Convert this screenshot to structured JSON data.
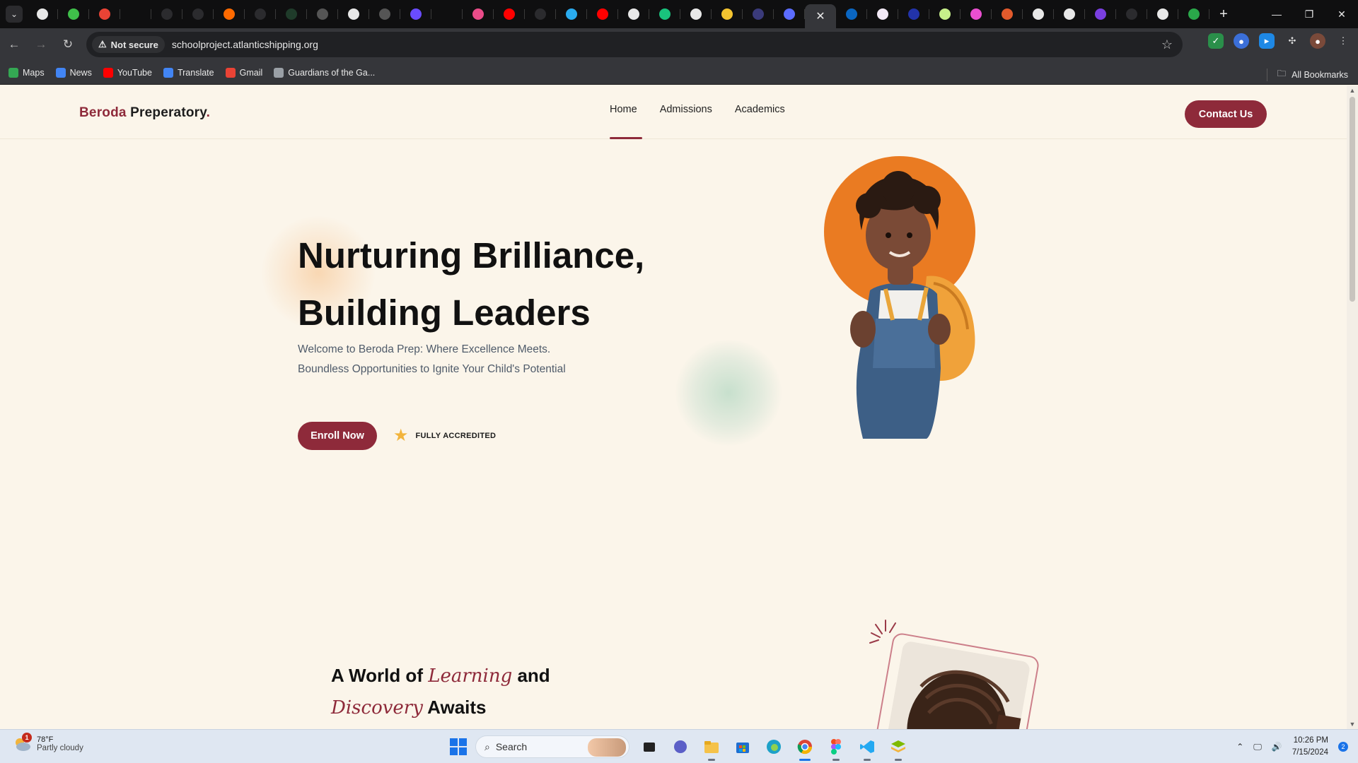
{
  "browser": {
    "tab_count_icons": [
      "chrome-icon",
      "green-icon",
      "gmail-icon",
      "blank",
      "github-icon",
      "github-icon",
      "fire-icon",
      "github-icon",
      "loading-icon",
      "circle-icon",
      "openai-icon",
      "circle-icon",
      "h-icon",
      "blank",
      "dribbble-icon",
      "youtube-icon",
      "github-icon",
      "telegram-icon",
      "youtube-icon",
      "triangle-icon",
      "chatgpt-icon",
      "t-icon",
      "yellow-icon",
      "dark-circle-icon",
      "box-icon",
      "active",
      "linkedin-icon",
      "cat-icon",
      "blue-circle-icon",
      "dot-icon",
      "pink-icon",
      "multi-icon",
      "triangle-icon",
      "window-icon",
      "purple-icon",
      "github-icon",
      "chrome-icon",
      "green-infinity-icon"
    ],
    "new_tab_label": "+",
    "security_label": "Not secure",
    "url": "schoolproject.atlanticshipping.org",
    "bookmarks": [
      {
        "label": "Maps",
        "color": "#34a853"
      },
      {
        "label": "News",
        "color": "#4285f4"
      },
      {
        "label": "YouTube",
        "color": "#ff0000"
      },
      {
        "label": "Translate",
        "color": "#4285f4"
      },
      {
        "label": "Gmail",
        "color": "#ea4335"
      },
      {
        "label": "Guardians of the Ga...",
        "color": "#9aa0a6"
      }
    ],
    "all_bookmarks_label": "All Bookmarks"
  },
  "site": {
    "logo_part1": "Beroda",
    "logo_part2": " Preperatory",
    "logo_dot": ".",
    "nav": {
      "home": "Home",
      "admissions": "Admissions",
      "academics": "Academics"
    },
    "contact_label": "Contact Us",
    "hero": {
      "title_line1": "Nurturing Brilliance,",
      "title_line2": "Building Leaders",
      "subtitle": "Welcome to Beroda Prep: Where Excellence Meets. Boundless Opportunities to Ignite Your Child's Potential",
      "enroll_label": "Enroll Now",
      "accredited_label": "FULLY ACCREDITED"
    },
    "section2": {
      "part1": "A World of ",
      "em1": "Learning",
      "part2": " and",
      "em2": "Discovery",
      "part3": " Awaits"
    },
    "colors": {
      "brand": "#8e2a3a",
      "hero_circle": "#ea7b22",
      "star": "#f2b43c",
      "background": "#fbf5ea"
    }
  },
  "taskbar": {
    "weather_temp": "78°F",
    "weather_desc": "Partly cloudy",
    "weather_badge": "1",
    "search_label": "Search",
    "time": "10:26 PM",
    "date": "7/15/2024",
    "notification_count": "2"
  }
}
